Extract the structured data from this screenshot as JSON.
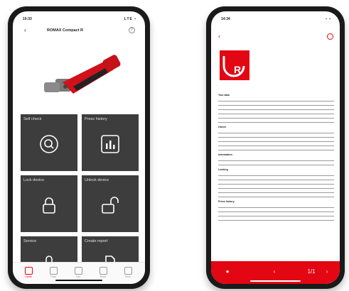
{
  "left_phone": {
    "status": {
      "time": "10:33",
      "signal": "LTE ▪"
    },
    "header": {
      "back": "‹",
      "title": "ROMAX Compact R",
      "help": "?"
    },
    "tiles": [
      {
        "label": "Self check",
        "icon": "search-icon"
      },
      {
        "label": "Press history",
        "icon": "bar-chart-icon"
      },
      {
        "label": "Lock device",
        "icon": "lock-icon"
      },
      {
        "label": "Unlock device",
        "icon": "unlock-icon"
      },
      {
        "label": "Service",
        "icon": "service-icon"
      },
      {
        "label": "Create report",
        "icon": "document-icon"
      }
    ],
    "tabs": [
      {
        "label": "Home",
        "active": true
      },
      {
        "label": "Tools",
        "active": false
      },
      {
        "label": "Info",
        "active": false
      },
      {
        "label": "News",
        "active": false
      },
      {
        "label": "More",
        "active": false
      }
    ]
  },
  "right_phone": {
    "status": {
      "time": "14:34",
      "signal": "▪ ▪"
    },
    "back": "‹",
    "logo_letter": "R",
    "sections": [
      {
        "title": "Tool data",
        "rows": 6
      },
      {
        "title": "Owner",
        "rows": 5
      },
      {
        "title": "Information",
        "rows": 2
      },
      {
        "title": "Locking",
        "rows": 6
      },
      {
        "title": "Press history",
        "rows": 4
      }
    ],
    "toolbar": {
      "left_icon": "●",
      "share_icon": "‹",
      "page": "1/1",
      "next": "›"
    }
  },
  "colors": {
    "accent": "#e30613",
    "tile": "#3d3d3d"
  }
}
